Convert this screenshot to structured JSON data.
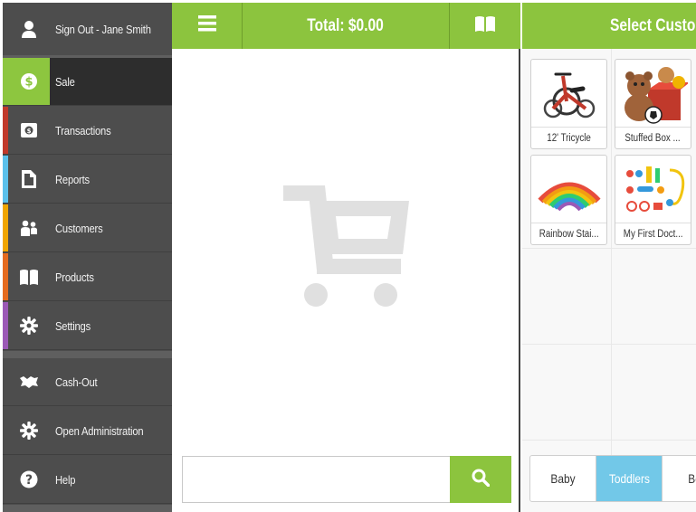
{
  "sidebar": {
    "signout": "Sign Out - Jane Smith",
    "items": [
      {
        "label": "Sale",
        "color": "#8dc63f"
      },
      {
        "label": "Transactions",
        "color": "#c0392b"
      },
      {
        "label": "Reports",
        "color": "#5bc0eb"
      },
      {
        "label": "Customers",
        "color": "#f0a500"
      },
      {
        "label": "Products",
        "color": "#e56b1f"
      },
      {
        "label": "Settings",
        "color": "#9b59b6"
      }
    ],
    "bottom": [
      {
        "label": "Cash-Out"
      },
      {
        "label": "Open Administration"
      },
      {
        "label": "Help"
      }
    ]
  },
  "cart": {
    "total_label": "Total: $0.00",
    "search_placeholder": ""
  },
  "products": {
    "header": "Select Custom",
    "tiles": [
      {
        "name": "12' Tricycle"
      },
      {
        "name": "Stuffed Box ..."
      },
      {
        "name": "Rainbow Stai..."
      },
      {
        "name": "My First Doct..."
      }
    ],
    "categories": [
      "Baby",
      "Toddlers",
      "Bo"
    ],
    "active_category": "Toddlers"
  },
  "colors": {
    "accent": "#8cc43e",
    "sidebar_bg": "#4d4d4d",
    "active_tab": "#72c8e8"
  }
}
